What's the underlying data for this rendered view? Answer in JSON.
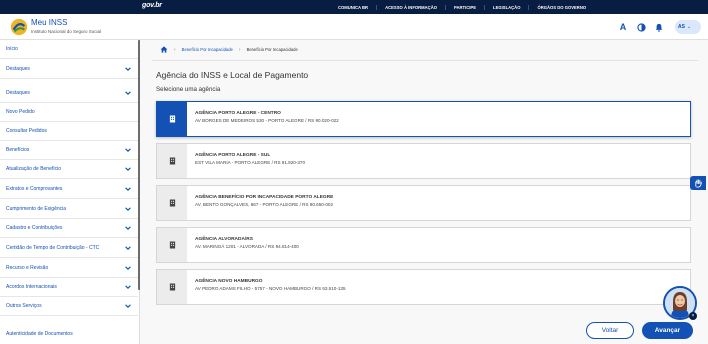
{
  "govbar": {
    "logo": "gov.br",
    "links": [
      "COMUNICA BR",
      "ACESSO À INFORMAÇÃO",
      "PARTICIPE",
      "LEGISLAÇÃO",
      "ÓRGÃOS DO GOVERNO"
    ]
  },
  "header": {
    "title": "Meu INSS",
    "subtitle": "Instituto Nacional do Seguro Social",
    "font_button": "A",
    "avatar_initials": "AS"
  },
  "sidebar": {
    "items": [
      {
        "label": "Início",
        "expandable": false
      },
      {
        "label": "Destaques",
        "expandable": true
      },
      {
        "label": "Destaques",
        "expandable": true
      },
      {
        "label": "Novo Pedido",
        "expandable": false
      },
      {
        "label": "Consultar Pedidos",
        "expandable": false
      },
      {
        "label": "Benefícios",
        "expandable": true
      },
      {
        "label": "Atualização de Benefício",
        "expandable": true
      },
      {
        "label": "Extratos e Comprovantes",
        "expandable": true
      },
      {
        "label": "Cumprimento de Exigência",
        "expandable": true
      },
      {
        "label": "Cadastro e Contribuições",
        "expandable": true
      },
      {
        "label": "Certidão de Tempo de Contribuição - CTC",
        "expandable": true
      },
      {
        "label": "Recurso e Revisão",
        "expandable": true
      },
      {
        "label": "Acordos Internacionais",
        "expandable": true
      },
      {
        "label": "Outros Serviços",
        "expandable": true
      },
      {
        "label": "Autenticidade de Documentos",
        "expandable": false
      }
    ]
  },
  "breadcrumb": {
    "items": [
      "Benefício Por Incapacidade",
      "Benefício Por Incapacidade"
    ]
  },
  "main": {
    "title": "Agência do INSS e Local de Pagamento",
    "subtitle": "Selecione uma agência",
    "agencies": [
      {
        "name": "AGÊNCIA PORTO ALEGRE - CENTRO",
        "address": "AV BORGES DE MEDEIROS 530 - PORTO ALEGRE / RS 90.020-022",
        "selected": true
      },
      {
        "name": "AGÊNCIA PORTO ALEGRE - SUL",
        "address": "EST VILA MARIA - PORTO ALEGRE / RS 91.920-370",
        "selected": false
      },
      {
        "name": "AGÊNCIA BENEFÍCIO POR INCAPACIDADE PORTO ALEGRE",
        "address": "AV. BENTO GONÇALVES, 867 - PORTO ALEGRE / RS 90.650-002",
        "selected": false
      },
      {
        "name": "AGÊNCIA ALVORADA/RS",
        "address": "AV. MARINGÁ 1201 - ALVORADA / RS 94.814-400",
        "selected": false
      },
      {
        "name": "AGÊNCIA NOVO HAMBURGO",
        "address": "AV PEDRO ADAMS FILHO - 5757 - NOVO HAMBURGO / RS 93.510-135",
        "selected": false
      }
    ],
    "back_label": "Voltar",
    "next_label": "Avançar"
  },
  "colors": {
    "govbar": "#071d41",
    "primary": "#1351b4",
    "background": "#f8f8f8"
  }
}
